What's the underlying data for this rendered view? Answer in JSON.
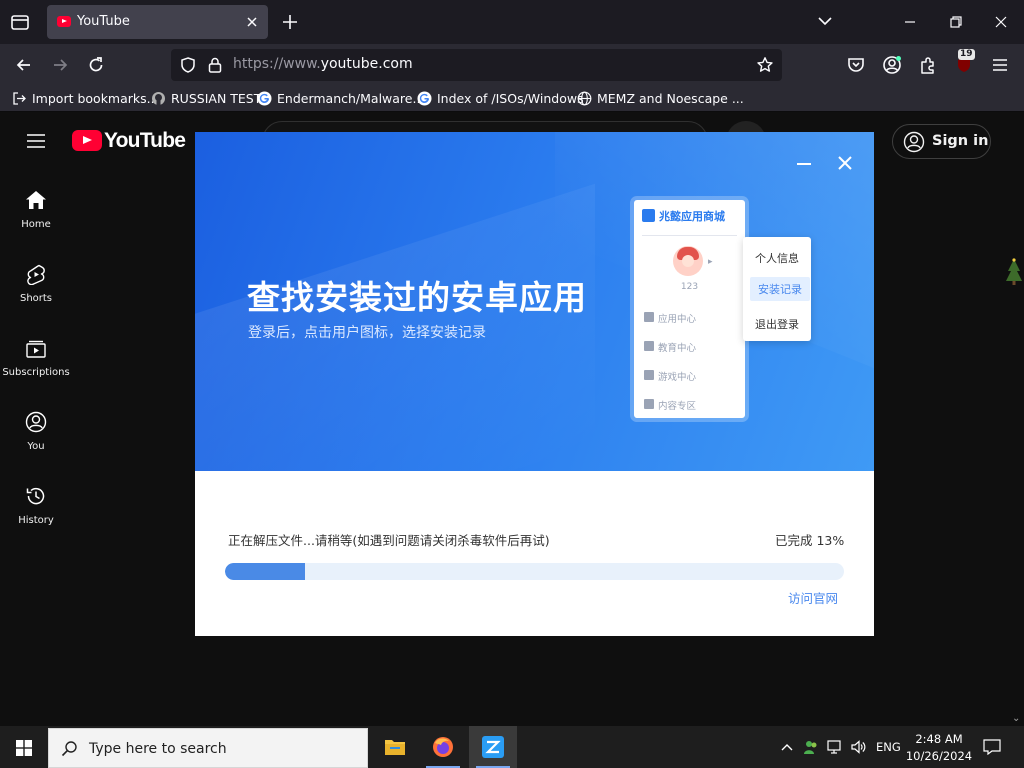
{
  "browser": {
    "tab": {
      "title": "YouTube"
    },
    "url": {
      "prefix": "https://www.",
      "host": "youtube.com"
    },
    "extension_badge": "19",
    "bookmarks": [
      {
        "label": "Import bookmarks...",
        "icon": "import-icon"
      },
      {
        "label": "RUSSIAN TEST",
        "icon": "github-icon"
      },
      {
        "label": "Endermanch/Malware...",
        "icon": "google-icon"
      },
      {
        "label": "Index of /ISOs/Windows",
        "icon": "google-icon"
      },
      {
        "label": "MEMZ and Noescape ...",
        "icon": "globe-icon"
      }
    ]
  },
  "youtube": {
    "wordmark": "YouTube",
    "signin": "Sign in",
    "sidebar": [
      {
        "label": "Home",
        "icon": "home-icon"
      },
      {
        "label": "Shorts",
        "icon": "shorts-icon"
      },
      {
        "label": "Subscriptions",
        "icon": "subscriptions-icon"
      },
      {
        "label": "You",
        "icon": "you-icon"
      },
      {
        "label": "History",
        "icon": "history-icon"
      }
    ]
  },
  "installer": {
    "headline": "查找安装过的安卓应用",
    "subline": "登录后，点击用户图标，选择安装记录",
    "mock": {
      "title": "兆懿应用商城",
      "user": "123",
      "menu": [
        "应用中心",
        "教育中心",
        "游戏中心",
        "内容专区"
      ],
      "popup": [
        "个人信息",
        "安装记录",
        "退出登录"
      ]
    },
    "status": "正在解压文件...请稍等(如遇到问题请关闭杀毒软件后再试)",
    "percent_label": "已完成 13%",
    "progress": 0.13,
    "visit_link": "访问官网",
    "accent": "#4a8ae6"
  },
  "taskbar": {
    "search_placeholder": "Type here to search",
    "lang": "ENG",
    "time": "2:48 AM",
    "date": "10/26/2024"
  }
}
